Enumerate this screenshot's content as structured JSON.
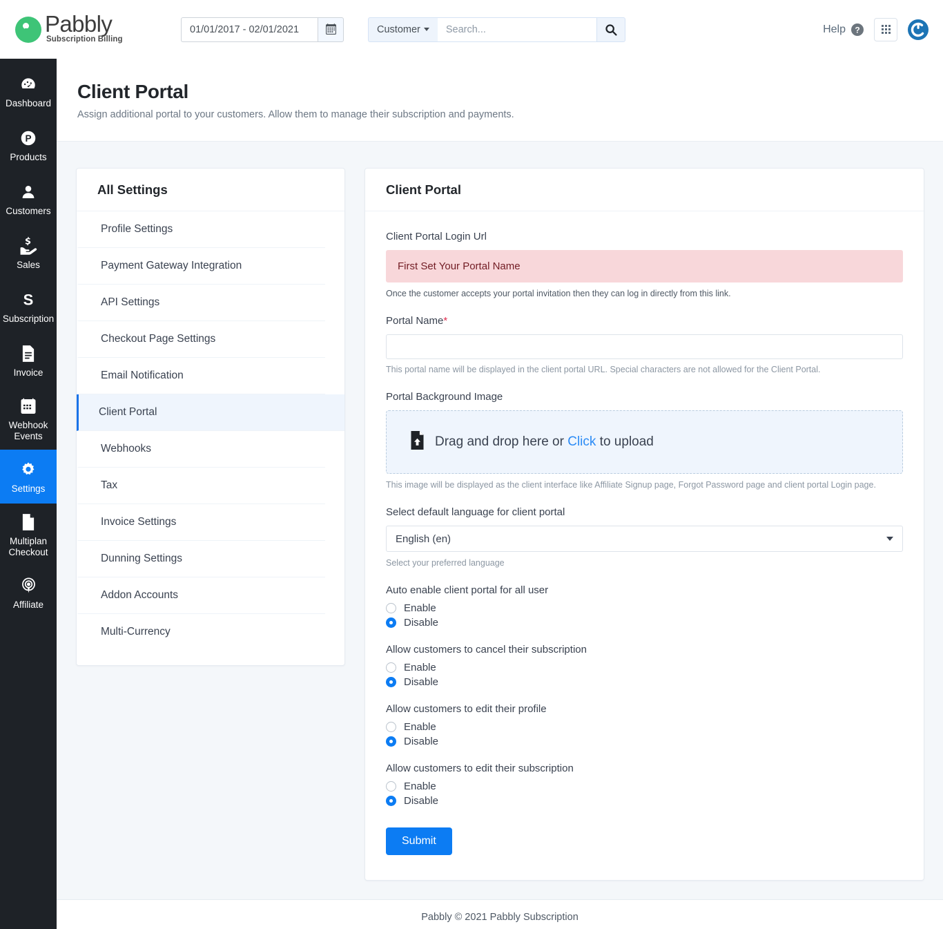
{
  "brand": {
    "name": "Pabbly",
    "tagline": "Subscription Billing",
    "logo_icon": "pabbly-logo-icon",
    "accent_green": "#3ec477"
  },
  "topbar": {
    "date_range_value": "01/01/2017 - 02/01/2021",
    "date_range_placeholder": "01/01/2017 - 02/01/2021",
    "calendar_icon": "calendar-icon",
    "search_scope_label": "Customer",
    "search_placeholder": "Search...",
    "search_value": "",
    "search_icon": "search-icon",
    "help_label": "Help",
    "help_icon": "question-circle-icon",
    "apps_icon": "grid-apps-icon",
    "avatar_icon": "user-avatar-icon",
    "avatar_color": "#1c74b5"
  },
  "sidebar": {
    "active_color": "#0c7cf3",
    "background": "#1e2227",
    "items": [
      {
        "label": "Dashboard",
        "icon": "dashboard-gauge-icon",
        "active": false
      },
      {
        "label": "Products",
        "icon": "products-p-circle-icon",
        "active": false
      },
      {
        "label": "Customers",
        "icon": "customers-user-icon",
        "active": false
      },
      {
        "label": "Sales",
        "icon": "sales-hand-money-icon",
        "active": false
      },
      {
        "label": "Subscription",
        "icon": "subscription-s-icon",
        "active": false
      },
      {
        "label": "Invoice",
        "icon": "invoice-document-icon",
        "active": false
      },
      {
        "label": "Webhook Events",
        "icon": "calendar-events-icon",
        "active": false
      },
      {
        "label": "Settings",
        "icon": "gear-icon",
        "active": true
      },
      {
        "label": "Multiplan Checkout",
        "icon": "page-file-icon",
        "active": false
      },
      {
        "label": "Affiliate",
        "icon": "affiliate-broadcast-icon",
        "active": false
      }
    ]
  },
  "page": {
    "title": "Client Portal",
    "subtitle": "Assign additional portal to your customers. Allow them to manage their subscription and payments."
  },
  "settings_panel": {
    "title": "All Settings",
    "items": [
      {
        "label": "Profile Settings",
        "active": false
      },
      {
        "label": "Payment Gateway Integration",
        "active": false
      },
      {
        "label": "API Settings",
        "active": false
      },
      {
        "label": "Checkout Page Settings",
        "active": false
      },
      {
        "label": "Email Notification",
        "active": false
      },
      {
        "label": "Client Portal",
        "active": true
      },
      {
        "label": "Webhooks",
        "active": false
      },
      {
        "label": "Tax",
        "active": false
      },
      {
        "label": "Invoice Settings",
        "active": false
      },
      {
        "label": "Dunning Settings",
        "active": false
      },
      {
        "label": "Addon Accounts",
        "active": false
      },
      {
        "label": "Multi-Currency",
        "active": false
      }
    ]
  },
  "portal_panel": {
    "title": "Client Portal",
    "login_url": {
      "label": "Client Portal Login Url",
      "alert_text": "First Set Your Portal Name",
      "alert_bg": "#f8d7da",
      "alert_color": "#721c24",
      "helper": "Once the customer accepts your portal invitation then they can log in directly from this link."
    },
    "portal_name": {
      "label": "Portal Name",
      "required_mark": "*",
      "value": "",
      "placeholder": "",
      "helper": "This portal name will be displayed in the client portal URL. Special characters are not allowed for the Client Portal."
    },
    "background_image": {
      "label": "Portal Background Image",
      "upload_icon": "file-upload-icon",
      "drop_text_before": "Drag and drop here or ",
      "drop_link": "Click",
      "drop_text_after": " to upload",
      "helper": "This image will be displayed as the client interface like Affiliate Signup page, Forgot Password page and client portal Login page."
    },
    "language": {
      "label": "Select default language for client portal",
      "selected": "English (en)",
      "helper": "Select your preferred language",
      "caret_icon": "chevron-down-icon"
    },
    "radio_groups": [
      {
        "label": "Auto enable client portal for all user",
        "options": [
          {
            "label": "Enable",
            "checked": false
          },
          {
            "label": "Disable",
            "checked": true
          }
        ]
      },
      {
        "label": "Allow customers to cancel their subscription",
        "options": [
          {
            "label": "Enable",
            "checked": false
          },
          {
            "label": "Disable",
            "checked": true
          }
        ]
      },
      {
        "label": "Allow customers to edit their profile",
        "options": [
          {
            "label": "Enable",
            "checked": false
          },
          {
            "label": "Disable",
            "checked": true
          }
        ]
      },
      {
        "label": "Allow customers to edit their subscription",
        "options": [
          {
            "label": "Enable",
            "checked": false
          },
          {
            "label": "Disable",
            "checked": true
          }
        ]
      }
    ],
    "submit_label": "Submit",
    "submit_color": "#0c7cf3"
  },
  "footer": {
    "text": "Pabbly © 2021 Pabbly Subscription"
  }
}
